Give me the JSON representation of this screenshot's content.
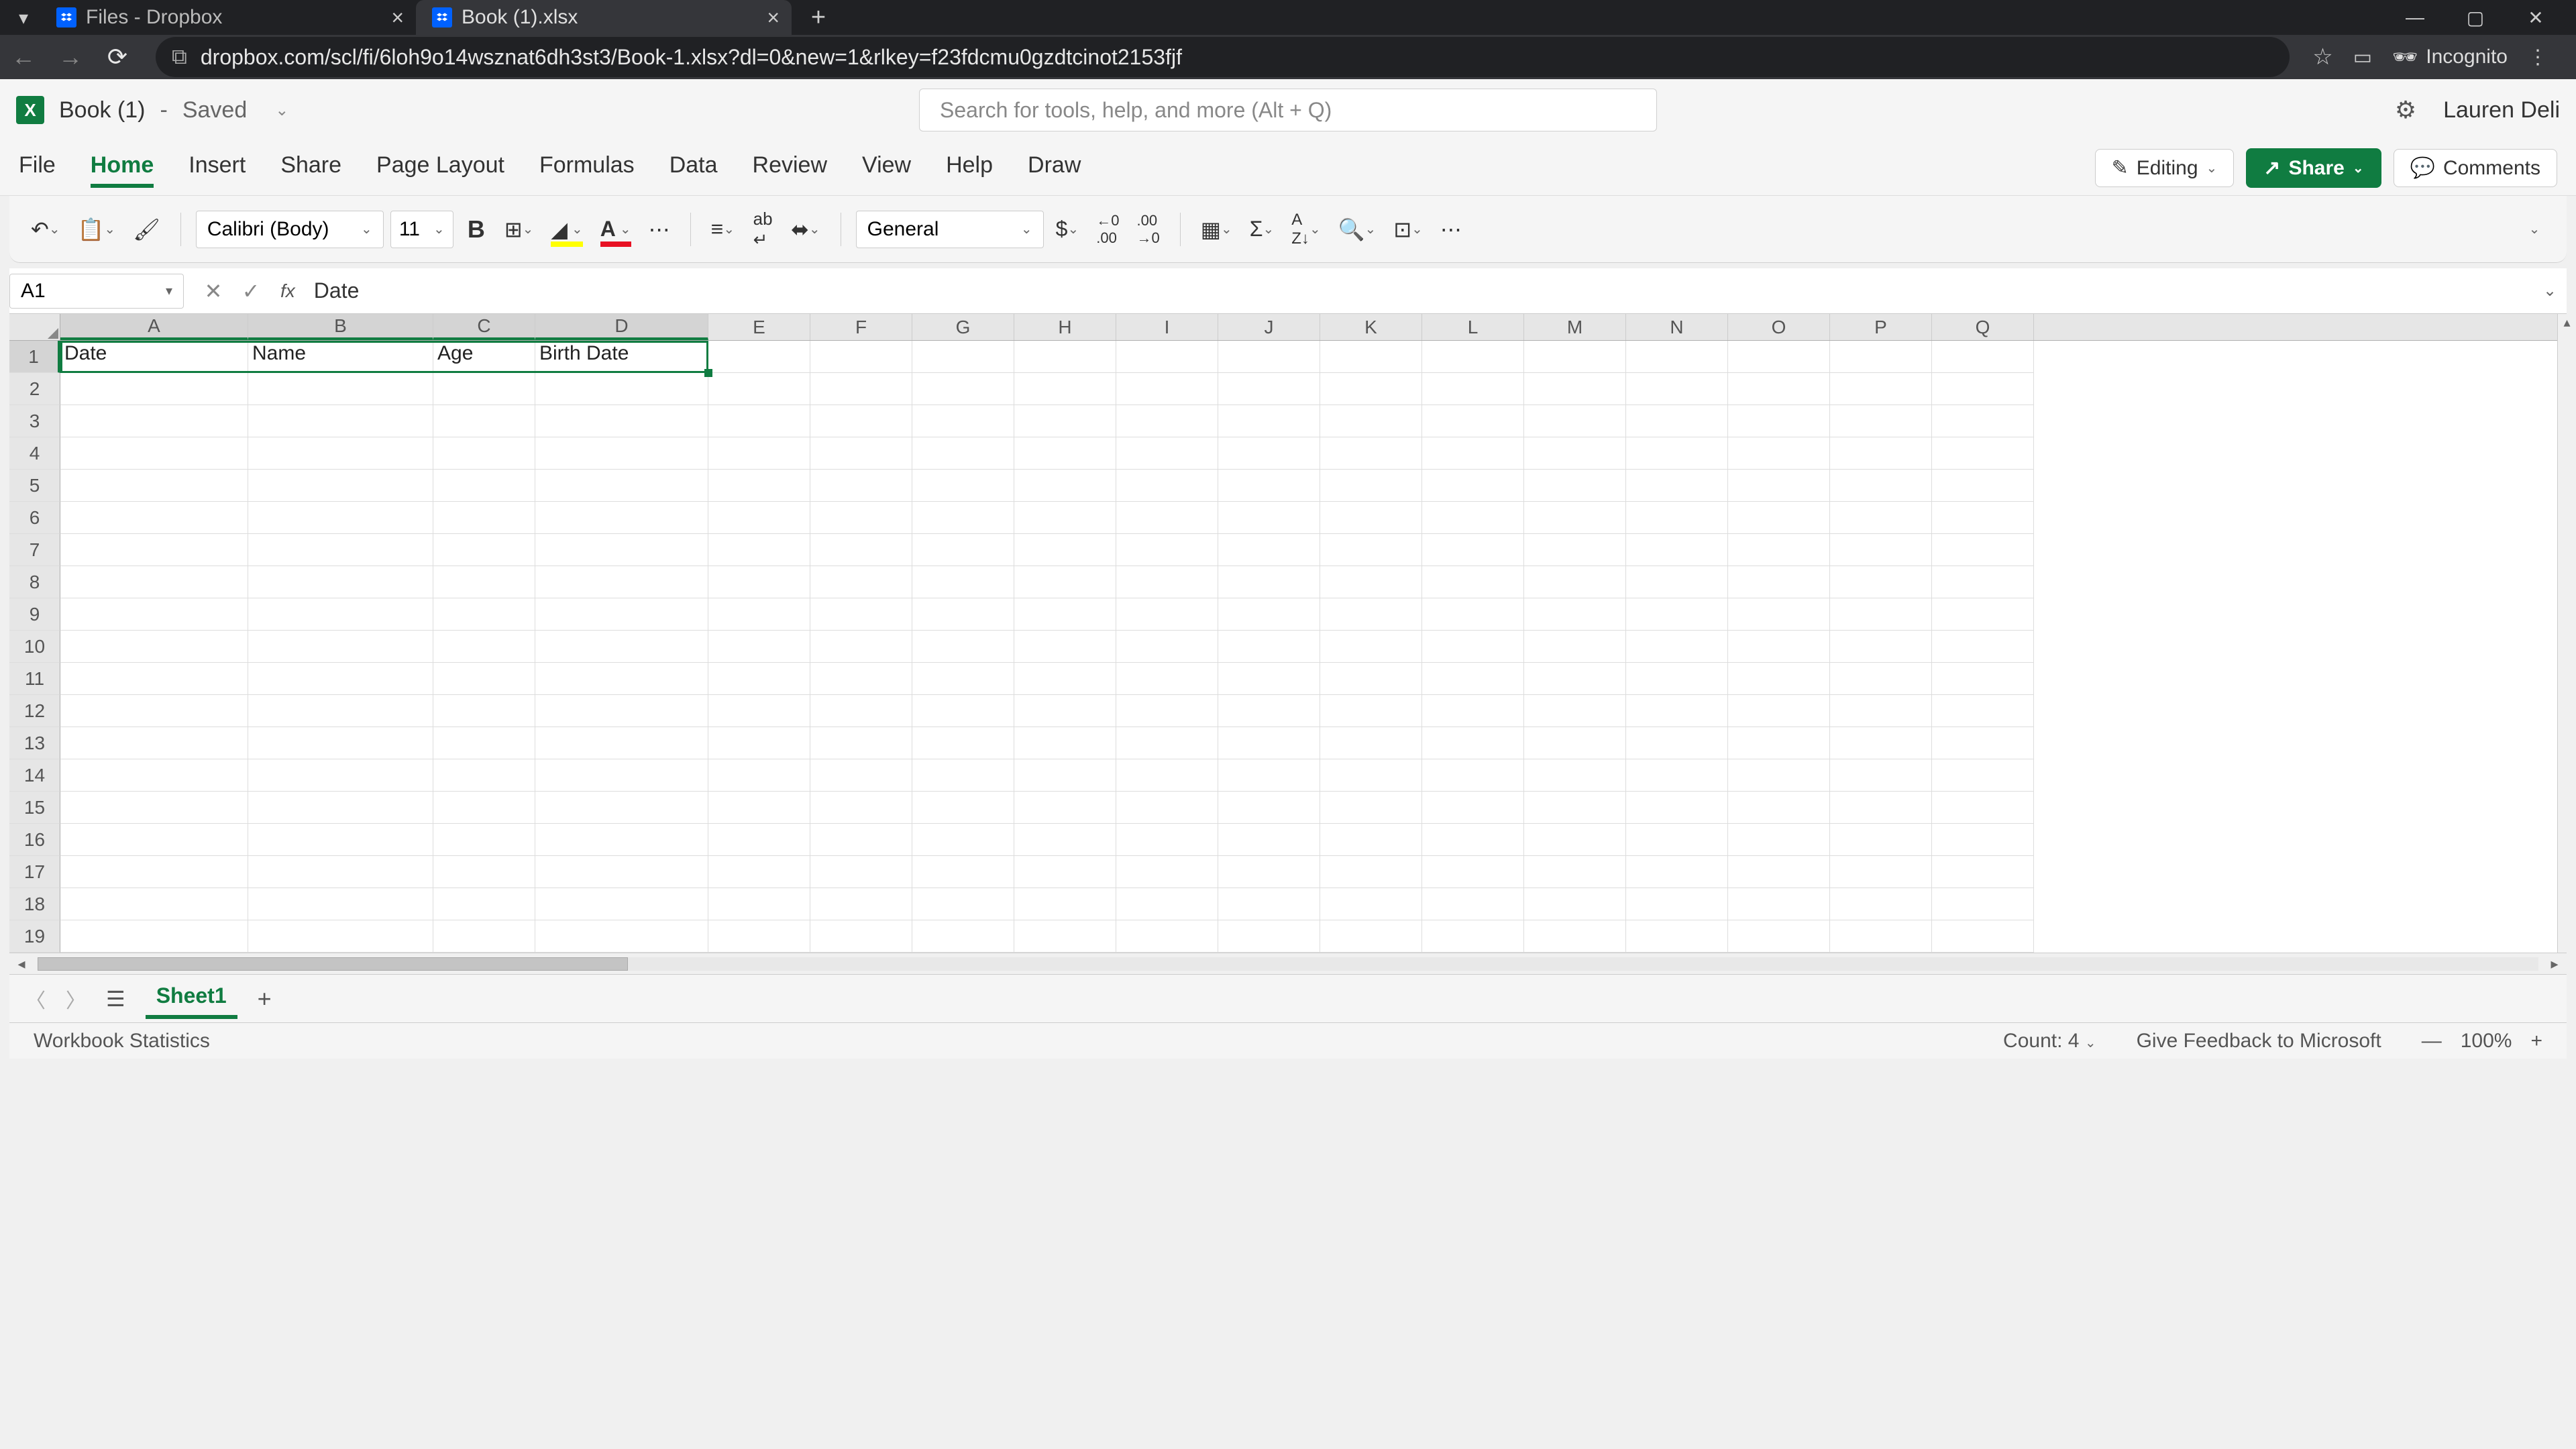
{
  "browser": {
    "tabs": [
      {
        "title": "Files - Dropbox"
      },
      {
        "title": "Book (1).xlsx"
      }
    ],
    "url": "dropbox.com/scl/fi/6loh9o14wsznat6dh3st3/Book-1.xlsx?dl=0&new=1&rlkey=f23fdcmu0gzdtcinot2153fjf",
    "incognito_label": "Incognito"
  },
  "header": {
    "doc_name": "Book (1)",
    "status_sep": "-",
    "status": "Saved",
    "search_placeholder": "Search for tools, help, and more (Alt + Q)",
    "user_name": "Lauren Deli"
  },
  "ribbon": {
    "tabs": [
      "File",
      "Home",
      "Insert",
      "Share",
      "Page Layout",
      "Formulas",
      "Data",
      "Review",
      "View",
      "Help",
      "Draw"
    ],
    "active": "Home",
    "mode_label": "Editing",
    "share_label": "Share",
    "comments_label": "Comments"
  },
  "toolbar": {
    "font_name": "Calibri (Body)",
    "font_size": "11",
    "number_format": "General"
  },
  "formula_bar": {
    "name_box": "A1",
    "formula": "Date"
  },
  "grid": {
    "columns": [
      "A",
      "B",
      "C",
      "D",
      "E",
      "F",
      "G",
      "H",
      "I",
      "J",
      "K",
      "L",
      "M",
      "N",
      "O",
      "P",
      "Q"
    ],
    "selected_cols": [
      "A",
      "B",
      "C",
      "D"
    ],
    "rows_visible": 19,
    "selected_rows": [
      1
    ],
    "data": {
      "1": {
        "A": "Date",
        "B": "Name",
        "C": "Age",
        "D": "Birth Date"
      }
    }
  },
  "sheets": {
    "active": "Sheet1"
  },
  "status": {
    "left": "Workbook Statistics",
    "count": "Count: 4",
    "feedback": "Give Feedback to Microsoft",
    "zoom": "100%"
  }
}
